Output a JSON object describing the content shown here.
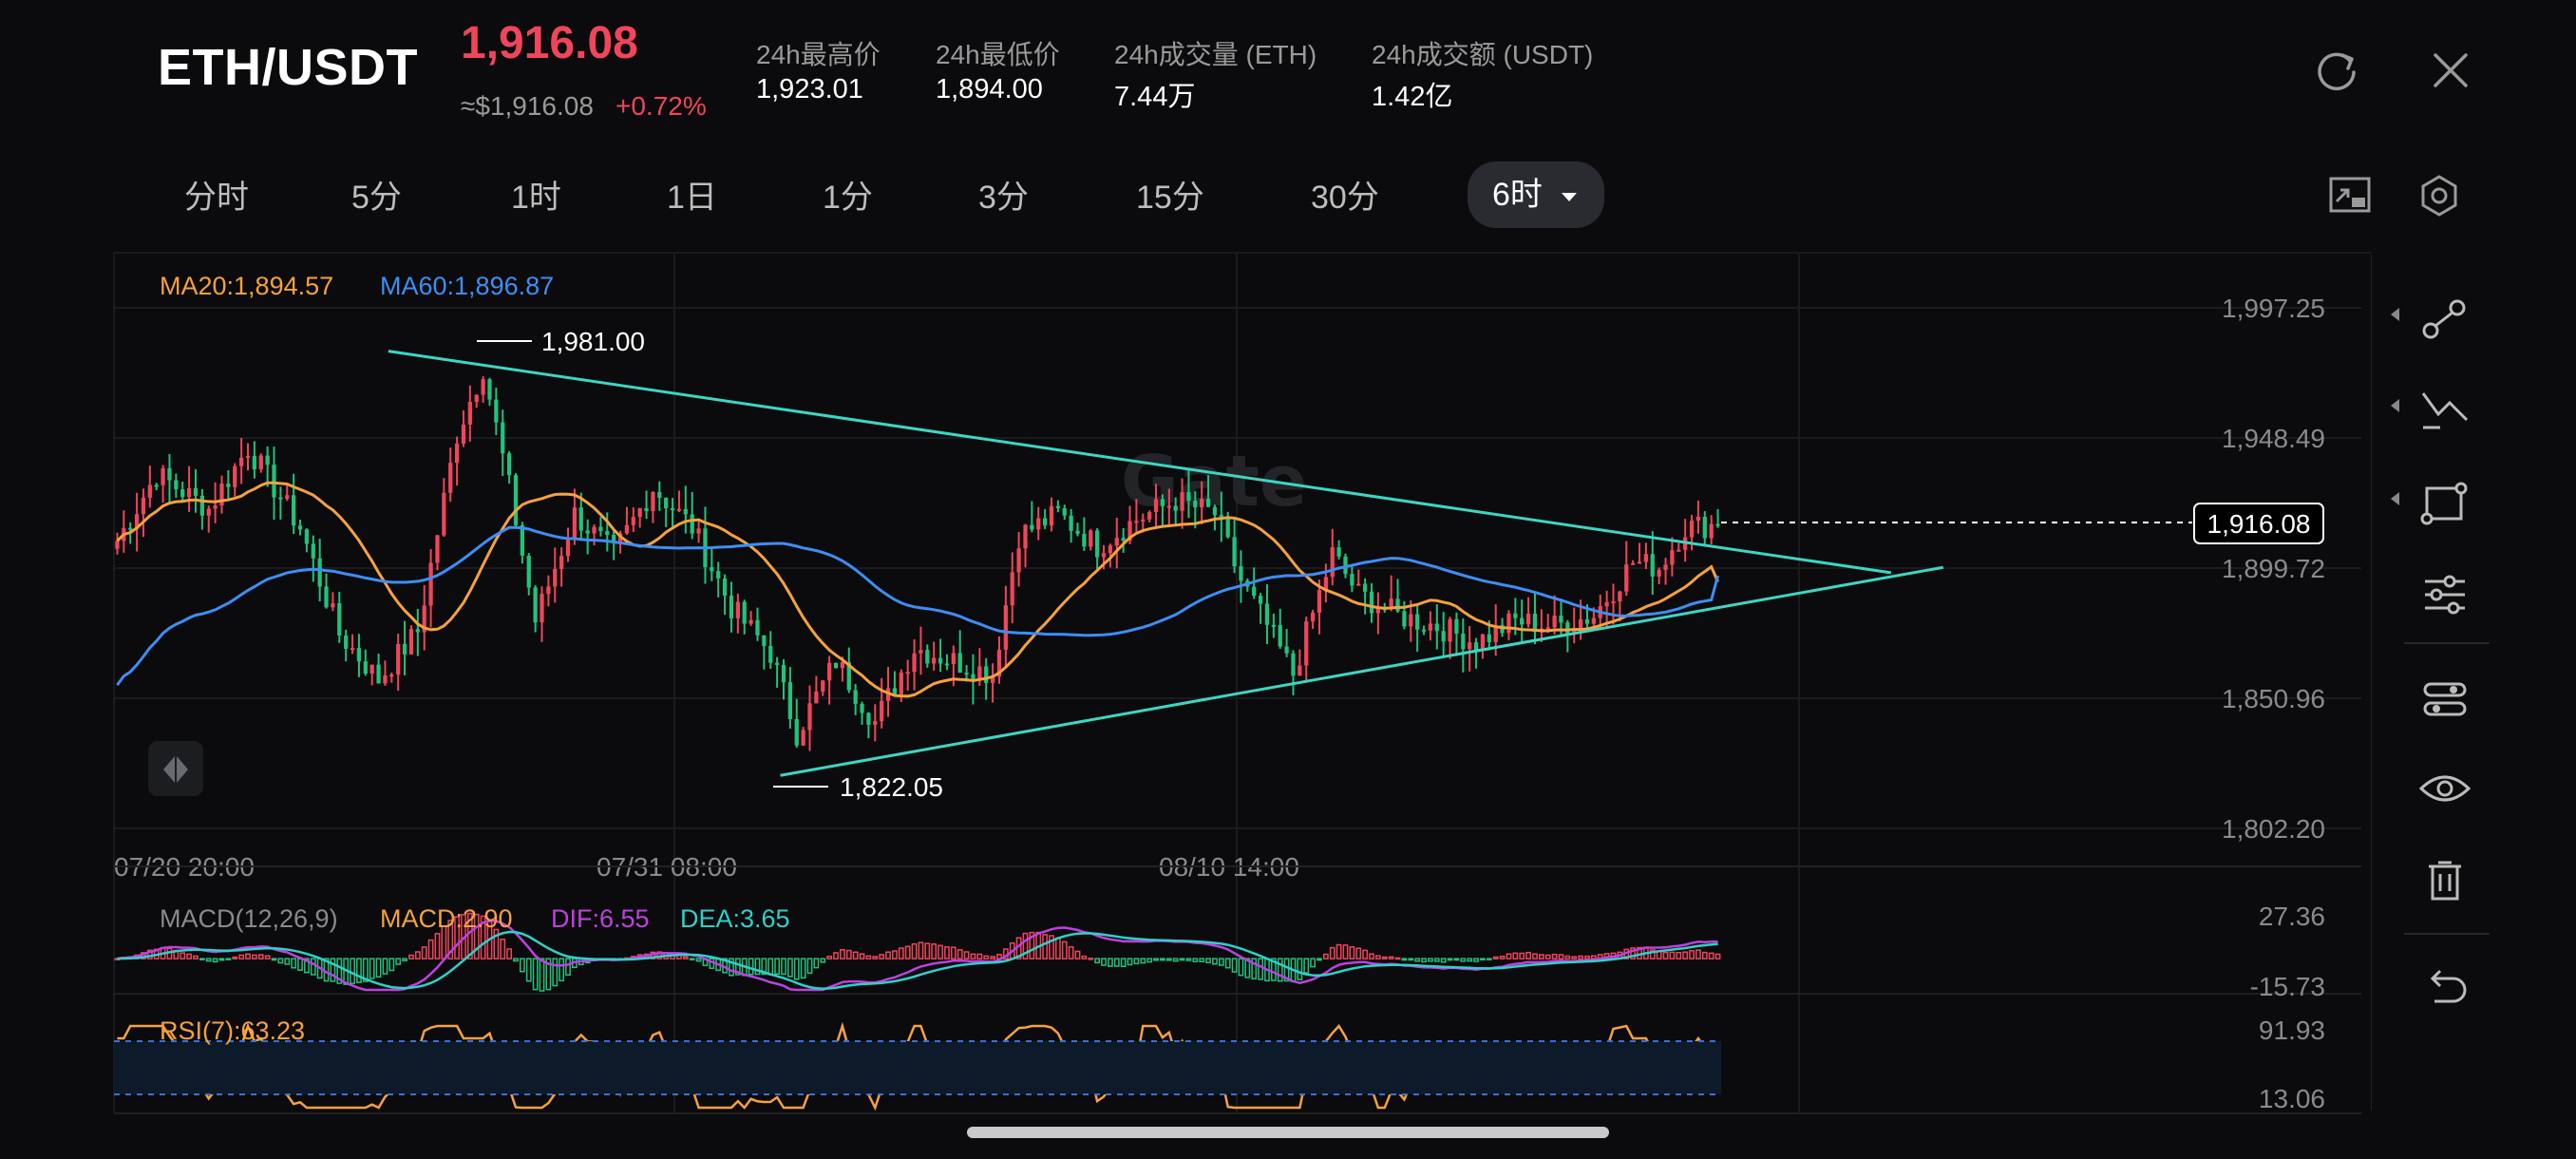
{
  "header": {
    "pair": "ETH/USDT",
    "price": "1,916.08",
    "price_usd": "≈$1,916.08",
    "change": "+0.72%",
    "stats": [
      {
        "label": "24h最高价",
        "value": "1,923.01"
      },
      {
        "label": "24h最低价",
        "value": "1,894.00"
      },
      {
        "label": "24h成交量 (ETH)",
        "value": "7.44万"
      },
      {
        "label": "24h成交额 (USDT)",
        "value": "1.42亿"
      }
    ]
  },
  "timeframes": {
    "items": [
      "分时",
      "5分",
      "1时",
      "1日",
      "1分",
      "3分",
      "15分",
      "30分"
    ],
    "active": "6时"
  },
  "chart": {
    "ma20_label": "MA20:1,894.57",
    "ma60_label": "MA60:1,896.87",
    "high_marker": "1,981.00",
    "low_marker": "1,822.05",
    "current_price": "1,916.08",
    "macd_label": "MACD(12,26,9)",
    "macd_value": "MACD:2.90",
    "dif_value": "DIF:6.55",
    "dea_value": "DEA:3.65",
    "rsi_label": "RSI(7):63.23",
    "watermark": "Gate"
  },
  "chart_data": {
    "type": "candlestick",
    "y_axis_ticks": [
      "1,997.25",
      "1,948.49",
      "1,899.72",
      "1,850.96",
      "1,802.20"
    ],
    "y_axis_values": [
      1997.25,
      1948.49,
      1899.72,
      1850.96,
      1802.2
    ],
    "ylim": [
      1802.2,
      1997.25
    ],
    "x_axis_ticks": [
      "07/20 20:00",
      "07/31 08:00",
      "08/10 14:00"
    ],
    "macd_ticks": [
      "27.36",
      "-15.73"
    ],
    "rsi_ticks": [
      "91.93",
      "13.06"
    ],
    "last_close": 1916.08,
    "period_high": 1981.0,
    "period_low": 1822.05,
    "ma20_last": 1894.57,
    "ma60_last": 1896.87,
    "rsi_last": 63.23,
    "macd_last": 2.9,
    "dif_last": 6.55,
    "dea_last": 3.65,
    "colors": {
      "up": "#f0455b",
      "down": "#20c37d",
      "ma20": "#f6a13c",
      "ma60": "#3d8ef5",
      "trend": "#3cd6c4",
      "dif": "#c040e0",
      "dea": "#30d0c8",
      "rsi": "#f6a13c"
    }
  }
}
